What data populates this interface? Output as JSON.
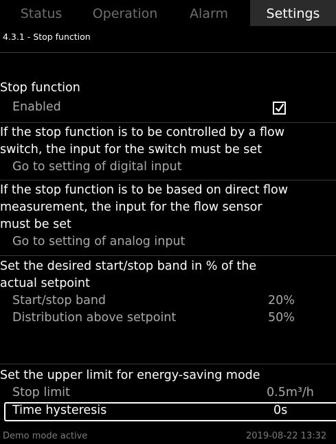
{
  "tabs": [
    {
      "label": "Status"
    },
    {
      "label": "Operation"
    },
    {
      "label": "Alarm"
    },
    {
      "label": "Settings"
    }
  ],
  "breadcrumb": "4.3.1 - Stop function",
  "stop_function": {
    "heading": "Stop function",
    "enabled_label": "Enabled",
    "enabled_checked": true
  },
  "flow_switch": {
    "text_line1": "If the stop function is to be controlled by a flow",
    "text_line2": "switch, the input for the switch must be set",
    "link": "Go to setting of digital input"
  },
  "flow_sensor": {
    "text_line1": "If the stop function is to be based on direct flow",
    "text_line2": "measurement, the input for the flow sensor",
    "text_line3": "must be set",
    "link": "Go to setting of analog input"
  },
  "band": {
    "text_line1": "Set the desired start/stop band in % of the",
    "text_line2": "actual setpoint",
    "start_stop_label": "Start/stop band",
    "start_stop_value": "20%",
    "distribution_label": "Distribution above setpoint",
    "distribution_value": "50%"
  },
  "energy": {
    "text": "Set the upper limit for energy-saving mode",
    "stop_limit_label": "Stop limit",
    "stop_limit_value": "0.5m³/h",
    "time_hysteresis_label": "Time hysteresis",
    "time_hysteresis_value": "0s"
  },
  "footer": {
    "demo": "Demo mode active",
    "datetime": "2019-08-22 13:32"
  },
  "colors": {
    "background": "#000000",
    "text": "#ffffff",
    "secondary_text": "#a9a9a9",
    "inactive_tab": "#6e6e6e",
    "active_tab_bg": "#2b2b2b"
  }
}
